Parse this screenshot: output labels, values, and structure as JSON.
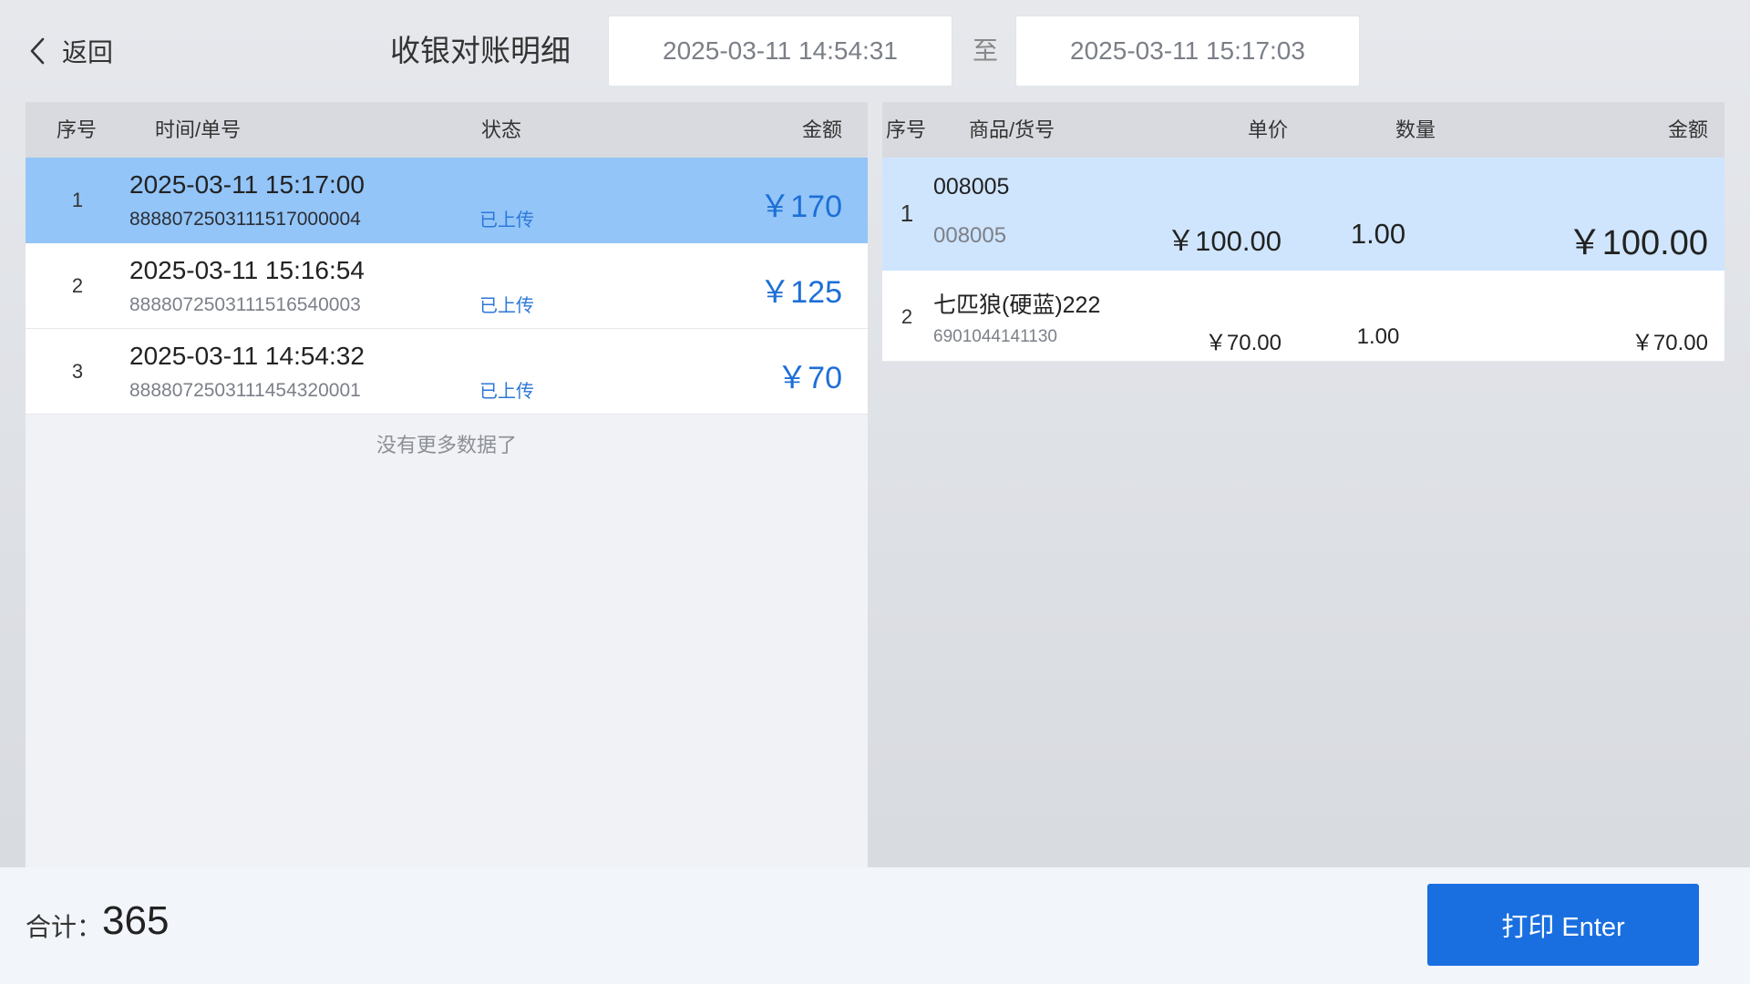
{
  "header": {
    "back_label": "返回",
    "title": "收银对账明细",
    "date_start": "2025-03-11 14:54:31",
    "date_separator": "至",
    "date_end": "2025-03-11 15:17:03"
  },
  "orders": {
    "columns": {
      "index": "序号",
      "time": "时间/单号",
      "status": "状态",
      "amount": "金额"
    },
    "rows": [
      {
        "index": "1",
        "time": "2025-03-11 15:17:00",
        "order_no": "8888072503111517000004",
        "status": "已上传",
        "amount": "￥170",
        "selected": true
      },
      {
        "index": "2",
        "time": "2025-03-11 15:16:54",
        "order_no": "8888072503111516540003",
        "status": "已上传",
        "amount": "￥125",
        "selected": false
      },
      {
        "index": "3",
        "time": "2025-03-11 14:54:32",
        "order_no": "8888072503111454320001",
        "status": "已上传",
        "amount": "￥70",
        "selected": false
      }
    ],
    "no_more": "没有更多数据了"
  },
  "items": {
    "columns": {
      "index": "序号",
      "goods": "商品/货号",
      "price": "单价",
      "qty": "数量",
      "amount": "金额"
    },
    "rows": [
      {
        "index": "1",
        "name": "008005",
        "code": "008005",
        "price": "￥100.00",
        "qty": "1.00",
        "amount": "￥100.00",
        "selected": true
      },
      {
        "index": "2",
        "name": "七匹狼(硬蓝)222",
        "code": "6901044141130",
        "price": "￥70.00",
        "qty": "1.00",
        "amount": "￥70.00",
        "selected": false
      }
    ]
  },
  "footer": {
    "total_label": "合计：",
    "total_value": "365",
    "print_label": "打印 Enter"
  },
  "colors": {
    "accent": "#1a6fe0",
    "selected_order": "#93c5f8",
    "selected_item": "#cfe5fd",
    "amount_text": "#1d6fd6"
  }
}
